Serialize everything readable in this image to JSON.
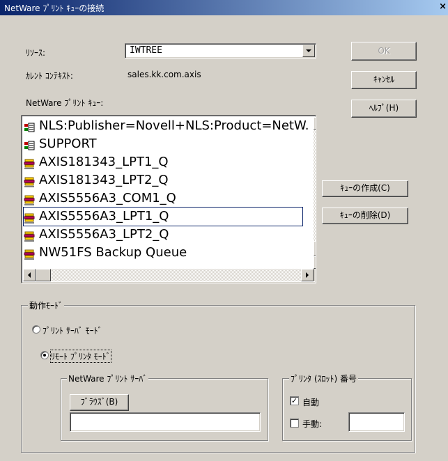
{
  "window": {
    "title": "NetWare ﾌﾟﾘﾝﾄ ｷｭｰの接続",
    "close": "×"
  },
  "resource": {
    "label": "ﾘｿｰｽ:",
    "value": "IWTREE"
  },
  "context": {
    "label": "ｶﾚﾝﾄ ｺﾝﾃｷｽﾄ:",
    "value": "sales.kk.com.axis"
  },
  "queues": {
    "label": "NetWare ﾌﾟﾘﾝﾄ ｷｭｰ:",
    "selected_index": 5,
    "items": [
      {
        "text": "NLS:Publisher=Novell+NLS:Product=NetW.",
        "icon": "directory-object-icon"
      },
      {
        "text": "SUPPORT",
        "icon": "directory-object-icon"
      },
      {
        "text": "AXIS181343_LPT1_Q",
        "icon": "print-queue-icon"
      },
      {
        "text": "AXIS181343_LPT2_Q",
        "icon": "print-queue-icon"
      },
      {
        "text": "AXIS5556A3_COM1_Q",
        "icon": "print-queue-icon"
      },
      {
        "text": "AXIS5556A3_LPT1_Q",
        "icon": "print-queue-icon"
      },
      {
        "text": "AXIS5556A3_LPT2_Q",
        "icon": "print-queue-icon"
      },
      {
        "text": "NW51FS Backup Queue",
        "icon": "print-queue-icon"
      }
    ]
  },
  "buttons": {
    "ok": "OK",
    "cancel": "ｷｬﾝｾﾙ",
    "help": "ﾍﾙﾌﾟ(H)",
    "create_queue": "ｷｭｰの作成(C)",
    "delete_queue": "ｷｭｰの削除(D)",
    "browse": "ﾌﾞﾗｳｽﾞ(B)"
  },
  "mode_group": {
    "title": "動作ﾓｰﾄﾞ",
    "print_server_mode": "ﾌﾟﾘﾝﾄ ｻｰﾊﾞ ﾓｰﾄﾞ",
    "remote_printer_mode": "ﾘﾓｰﾄ ﾌﾟﾘﾝﾀ ﾓｰﾄﾞ",
    "selected": "remote_printer_mode"
  },
  "server_group": {
    "title": "NetWare ﾌﾟﾘﾝﾄ ｻｰﾊﾞ",
    "value": ""
  },
  "slot_group": {
    "title": "ﾌﾟﾘﾝﾀ (ｽﾛｯﾄ) 番号",
    "auto": "自動",
    "auto_checked": true,
    "manual": "手動:",
    "manual_checked": false,
    "manual_value": ""
  },
  "colors": {
    "title_start": "#0a246a",
    "title_end": "#a6caf0",
    "face": "#d4d0c8"
  }
}
